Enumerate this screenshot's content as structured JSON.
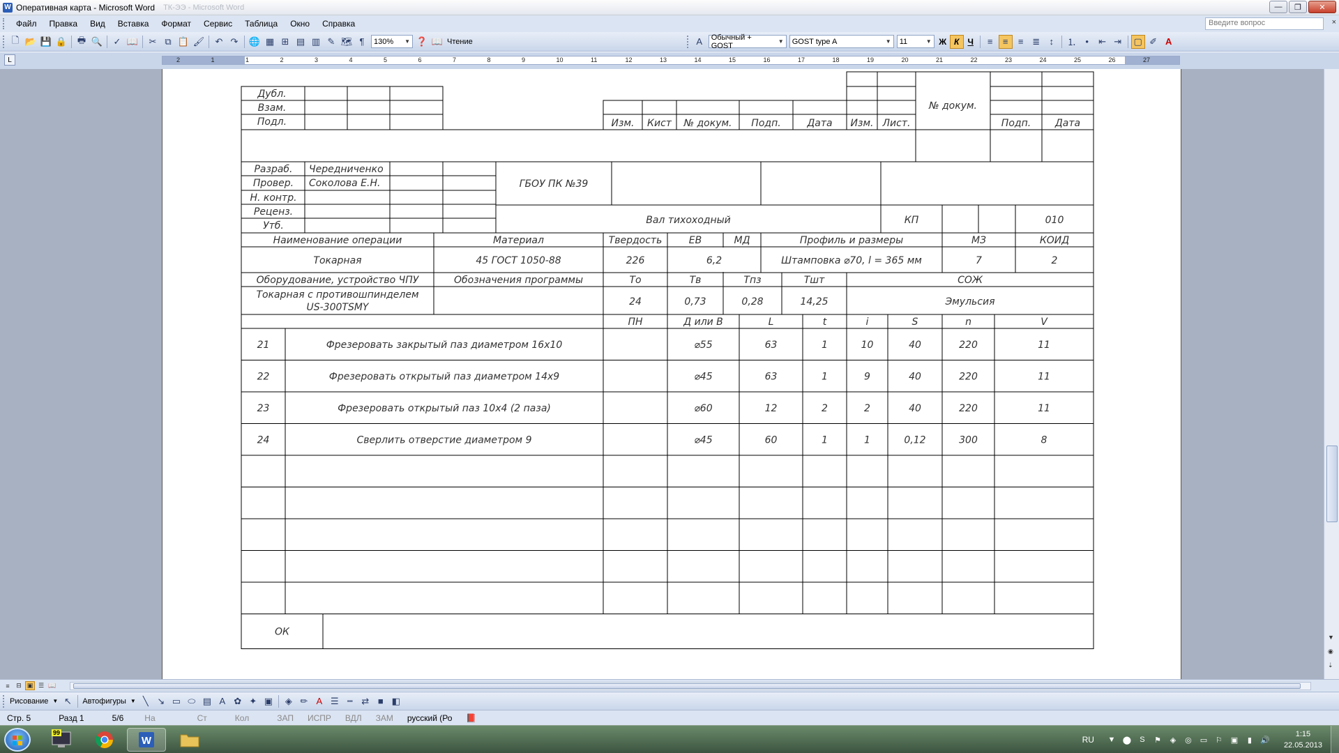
{
  "window": {
    "title": "Оперативная карта - Microsoft Word",
    "ghost_title": "ТК-ЭЭ - Microsoft Word",
    "min_label": "—",
    "max_label": "❐",
    "close_label": "✕"
  },
  "menu": {
    "items": [
      "Файл",
      "Правка",
      "Вид",
      "Вставка",
      "Формат",
      "Сервис",
      "Таблица",
      "Окно",
      "Справка"
    ],
    "help_placeholder": "Введите вопрос",
    "help_close": "×"
  },
  "toolbar": {
    "zoom": "130%",
    "reading_label": "Чтение",
    "style": "Обычный + GOST",
    "font": "GOST type A",
    "size": "11",
    "bold": "Ж",
    "italic": "К",
    "underline": "Ч"
  },
  "ruler": {
    "numbers": [
      "2",
      "1",
      "1",
      "2",
      "3",
      "4",
      "5",
      "6",
      "7",
      "8",
      "9",
      "10",
      "11",
      "12",
      "13",
      "14",
      "15",
      "16",
      "17",
      "18",
      "19",
      "20",
      "21",
      "22",
      "23",
      "24",
      "25",
      "26",
      "27"
    ]
  },
  "form": {
    "stamp_left": [
      "Дубл.",
      "Взам.",
      "Подл."
    ],
    "stamp_right_headers": [
      "Изм.",
      "Кист",
      "№ докум.",
      "Подп.",
      "Дата",
      "Изм.",
      "Лист.",
      "№ докум.",
      "Подп.",
      "Дата"
    ],
    "signers": [
      {
        "role": "Разраб.",
        "name": "Чередниченко"
      },
      {
        "role": "Провер.",
        "name": "Соколова Е.Н."
      },
      {
        "role": "Н. контр.",
        "name": ""
      },
      {
        "role": "Реценз.",
        "name": ""
      },
      {
        "role": "Утб.",
        "name": ""
      }
    ],
    "organization": "ГБОУ ПК №39",
    "part_name": "Вал тихоходный",
    "kp_label": "КП",
    "op_code": "010",
    "op_header": [
      "Наименование операции",
      "Материал",
      "Твердость",
      "ЕВ",
      "МД",
      "Профиль и размеры",
      "МЗ",
      "КОИД"
    ],
    "op_values": [
      "Токарная",
      "45 ГОСТ 1050-88",
      "226",
      "",
      "6,2",
      "Штамповка ⌀70, l = 365 мм",
      "7",
      "2"
    ],
    "equip_header": [
      "Оборудование, устройство ЧПУ",
      "Обозначения программы",
      "То",
      "Тв",
      "Тпз",
      "Тшт",
      "СОЖ"
    ],
    "equip_values": [
      "Токарная с противошпинделем",
      "US-300TSMY",
      "",
      "24",
      "0,73",
      "0,28",
      "14,25",
      "Эмульсия"
    ],
    "step_header": [
      "ПН",
      "Д или В",
      "L",
      "t",
      "i",
      "S",
      "n",
      "V"
    ],
    "steps": [
      {
        "num": "21",
        "text": "Фрезеровать закрытый паз диаметром 16х10",
        "pn": "",
        "d": "⌀55",
        "l": "63",
        "t": "1",
        "i": "10",
        "s": "40",
        "n": "220",
        "v": "11"
      },
      {
        "num": "22",
        "text": "Фрезеровать открытый паз диаметром 14х9",
        "pn": "",
        "d": "⌀45",
        "l": "63",
        "t": "1",
        "i": "9",
        "s": "40",
        "n": "220",
        "v": "11"
      },
      {
        "num": "23",
        "text": "Фрезеровать открытый паз 10х4 (2 паза)",
        "pn": "",
        "d": "⌀60",
        "l": "12",
        "t": "2",
        "i": "2",
        "s": "40",
        "n": "220",
        "v": "11"
      },
      {
        "num": "24",
        "text": "Сверлить отверстие диаметром 9",
        "pn": "",
        "d": "⌀45",
        "l": "60",
        "t": "1",
        "i": "1",
        "s": "0,12",
        "n": "300",
        "v": "8"
      }
    ],
    "footer_label": "ОК"
  },
  "drawbar": {
    "drawing": "Рисование",
    "autoshapes": "Автофигуры"
  },
  "status": {
    "page": "Стр. 5",
    "section": "Разд 1",
    "pages": "5/6",
    "at": "На",
    "line": "Ст",
    "col": "Кол",
    "rec": "ЗАП",
    "trk": "ИСПР",
    "ext": "ВДЛ",
    "ovr": "ЗАМ",
    "lang": "русский (Ро"
  },
  "taskbar": {
    "lang": "RU",
    "time": "1:15",
    "date": "22.05.2013",
    "badge": "99"
  }
}
